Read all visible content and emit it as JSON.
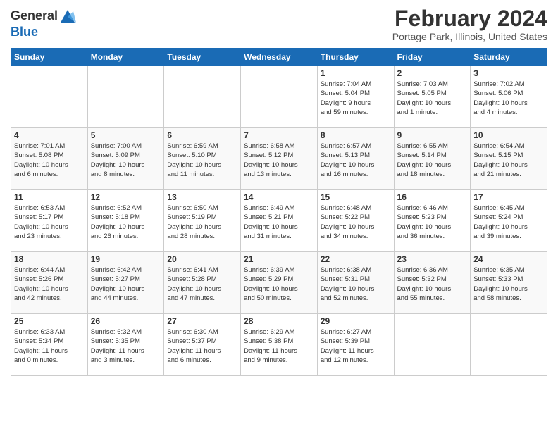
{
  "header": {
    "logo": "GeneralBlue",
    "title": "February 2024",
    "location": "Portage Park, Illinois, United States"
  },
  "weekdays": [
    "Sunday",
    "Monday",
    "Tuesday",
    "Wednesday",
    "Thursday",
    "Friday",
    "Saturday"
  ],
  "weeks": [
    [
      {
        "day": "",
        "info": ""
      },
      {
        "day": "",
        "info": ""
      },
      {
        "day": "",
        "info": ""
      },
      {
        "day": "",
        "info": ""
      },
      {
        "day": "1",
        "info": "Sunrise: 7:04 AM\nSunset: 5:04 PM\nDaylight: 9 hours\nand 59 minutes."
      },
      {
        "day": "2",
        "info": "Sunrise: 7:03 AM\nSunset: 5:05 PM\nDaylight: 10 hours\nand 1 minute."
      },
      {
        "day": "3",
        "info": "Sunrise: 7:02 AM\nSunset: 5:06 PM\nDaylight: 10 hours\nand 4 minutes."
      }
    ],
    [
      {
        "day": "4",
        "info": "Sunrise: 7:01 AM\nSunset: 5:08 PM\nDaylight: 10 hours\nand 6 minutes."
      },
      {
        "day": "5",
        "info": "Sunrise: 7:00 AM\nSunset: 5:09 PM\nDaylight: 10 hours\nand 8 minutes."
      },
      {
        "day": "6",
        "info": "Sunrise: 6:59 AM\nSunset: 5:10 PM\nDaylight: 10 hours\nand 11 minutes."
      },
      {
        "day": "7",
        "info": "Sunrise: 6:58 AM\nSunset: 5:12 PM\nDaylight: 10 hours\nand 13 minutes."
      },
      {
        "day": "8",
        "info": "Sunrise: 6:57 AM\nSunset: 5:13 PM\nDaylight: 10 hours\nand 16 minutes."
      },
      {
        "day": "9",
        "info": "Sunrise: 6:55 AM\nSunset: 5:14 PM\nDaylight: 10 hours\nand 18 minutes."
      },
      {
        "day": "10",
        "info": "Sunrise: 6:54 AM\nSunset: 5:15 PM\nDaylight: 10 hours\nand 21 minutes."
      }
    ],
    [
      {
        "day": "11",
        "info": "Sunrise: 6:53 AM\nSunset: 5:17 PM\nDaylight: 10 hours\nand 23 minutes."
      },
      {
        "day": "12",
        "info": "Sunrise: 6:52 AM\nSunset: 5:18 PM\nDaylight: 10 hours\nand 26 minutes."
      },
      {
        "day": "13",
        "info": "Sunrise: 6:50 AM\nSunset: 5:19 PM\nDaylight: 10 hours\nand 28 minutes."
      },
      {
        "day": "14",
        "info": "Sunrise: 6:49 AM\nSunset: 5:21 PM\nDaylight: 10 hours\nand 31 minutes."
      },
      {
        "day": "15",
        "info": "Sunrise: 6:48 AM\nSunset: 5:22 PM\nDaylight: 10 hours\nand 34 minutes."
      },
      {
        "day": "16",
        "info": "Sunrise: 6:46 AM\nSunset: 5:23 PM\nDaylight: 10 hours\nand 36 minutes."
      },
      {
        "day": "17",
        "info": "Sunrise: 6:45 AM\nSunset: 5:24 PM\nDaylight: 10 hours\nand 39 minutes."
      }
    ],
    [
      {
        "day": "18",
        "info": "Sunrise: 6:44 AM\nSunset: 5:26 PM\nDaylight: 10 hours\nand 42 minutes."
      },
      {
        "day": "19",
        "info": "Sunrise: 6:42 AM\nSunset: 5:27 PM\nDaylight: 10 hours\nand 44 minutes."
      },
      {
        "day": "20",
        "info": "Sunrise: 6:41 AM\nSunset: 5:28 PM\nDaylight: 10 hours\nand 47 minutes."
      },
      {
        "day": "21",
        "info": "Sunrise: 6:39 AM\nSunset: 5:29 PM\nDaylight: 10 hours\nand 50 minutes."
      },
      {
        "day": "22",
        "info": "Sunrise: 6:38 AM\nSunset: 5:31 PM\nDaylight: 10 hours\nand 52 minutes."
      },
      {
        "day": "23",
        "info": "Sunrise: 6:36 AM\nSunset: 5:32 PM\nDaylight: 10 hours\nand 55 minutes."
      },
      {
        "day": "24",
        "info": "Sunrise: 6:35 AM\nSunset: 5:33 PM\nDaylight: 10 hours\nand 58 minutes."
      }
    ],
    [
      {
        "day": "25",
        "info": "Sunrise: 6:33 AM\nSunset: 5:34 PM\nDaylight: 11 hours\nand 0 minutes."
      },
      {
        "day": "26",
        "info": "Sunrise: 6:32 AM\nSunset: 5:35 PM\nDaylight: 11 hours\nand 3 minutes."
      },
      {
        "day": "27",
        "info": "Sunrise: 6:30 AM\nSunset: 5:37 PM\nDaylight: 11 hours\nand 6 minutes."
      },
      {
        "day": "28",
        "info": "Sunrise: 6:29 AM\nSunset: 5:38 PM\nDaylight: 11 hours\nand 9 minutes."
      },
      {
        "day": "29",
        "info": "Sunrise: 6:27 AM\nSunset: 5:39 PM\nDaylight: 11 hours\nand 12 minutes."
      },
      {
        "day": "",
        "info": ""
      },
      {
        "day": "",
        "info": ""
      }
    ]
  ]
}
